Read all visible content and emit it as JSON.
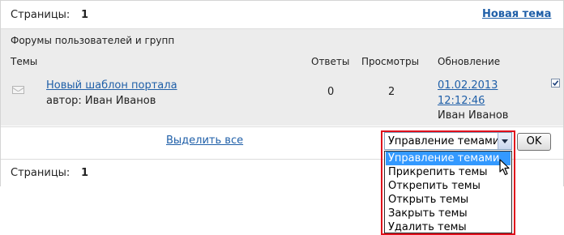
{
  "pagination_top": {
    "label": "Страницы:",
    "page": "1"
  },
  "new_topic_link": "Новая тема",
  "forum_title": "Форумы пользователей и групп",
  "columns": {
    "topics": "Темы",
    "replies": "Ответы",
    "views": "Просмотры",
    "updated": "Обновление"
  },
  "topics": [
    {
      "title": "Новый шаблон портала",
      "author": "автор: Иван Иванов",
      "replies": "0",
      "views": "2",
      "updated_date": "01.02.2013",
      "updated_time": "12:12:46",
      "updated_by": "Иван Иванов",
      "checked": true
    }
  ],
  "select_all_link": "Выделить все",
  "topic_action_select": {
    "selected": "Управление темами",
    "options": [
      "Управление темами",
      "Прикрепить темы",
      "Открепить темы",
      "Открыть темы",
      "Закрыть темы",
      "Удалить темы"
    ]
  },
  "ok_button": "OK",
  "pagination_bottom": {
    "label": "Страницы:",
    "page": "1"
  },
  "icons": {
    "topic_icon": "envelope-icon",
    "select_arrow": "chevron-down-icon",
    "cursor": "mouse-pointer-icon"
  },
  "colors": {
    "link": "#1f5fa8",
    "selected_option": "#3399ff",
    "highlight": "#e0101c",
    "row_bg": "#ececec"
  }
}
